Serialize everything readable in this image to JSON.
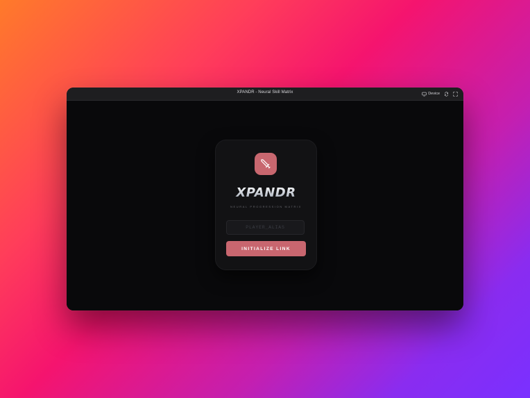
{
  "window": {
    "title": "XPANDR - Neural Skill Matrix",
    "device_label": "Device",
    "icons": [
      "device-icon",
      "rotate-icon",
      "expand-icon"
    ]
  },
  "login": {
    "logo_icon": "sword-icon",
    "brand": "XPANDR",
    "subtitle": "NEURAL PROGRESSION MATRIX",
    "alias_placeholder": "PLAYER_ALIAS",
    "alias_value": "",
    "submit_label": "INITIALIZE LINK"
  },
  "colors": {
    "accent": "#c8666f",
    "window_bg": "#09090b",
    "card_bg": "#121214",
    "titlebar_bg": "#1e1e20"
  }
}
